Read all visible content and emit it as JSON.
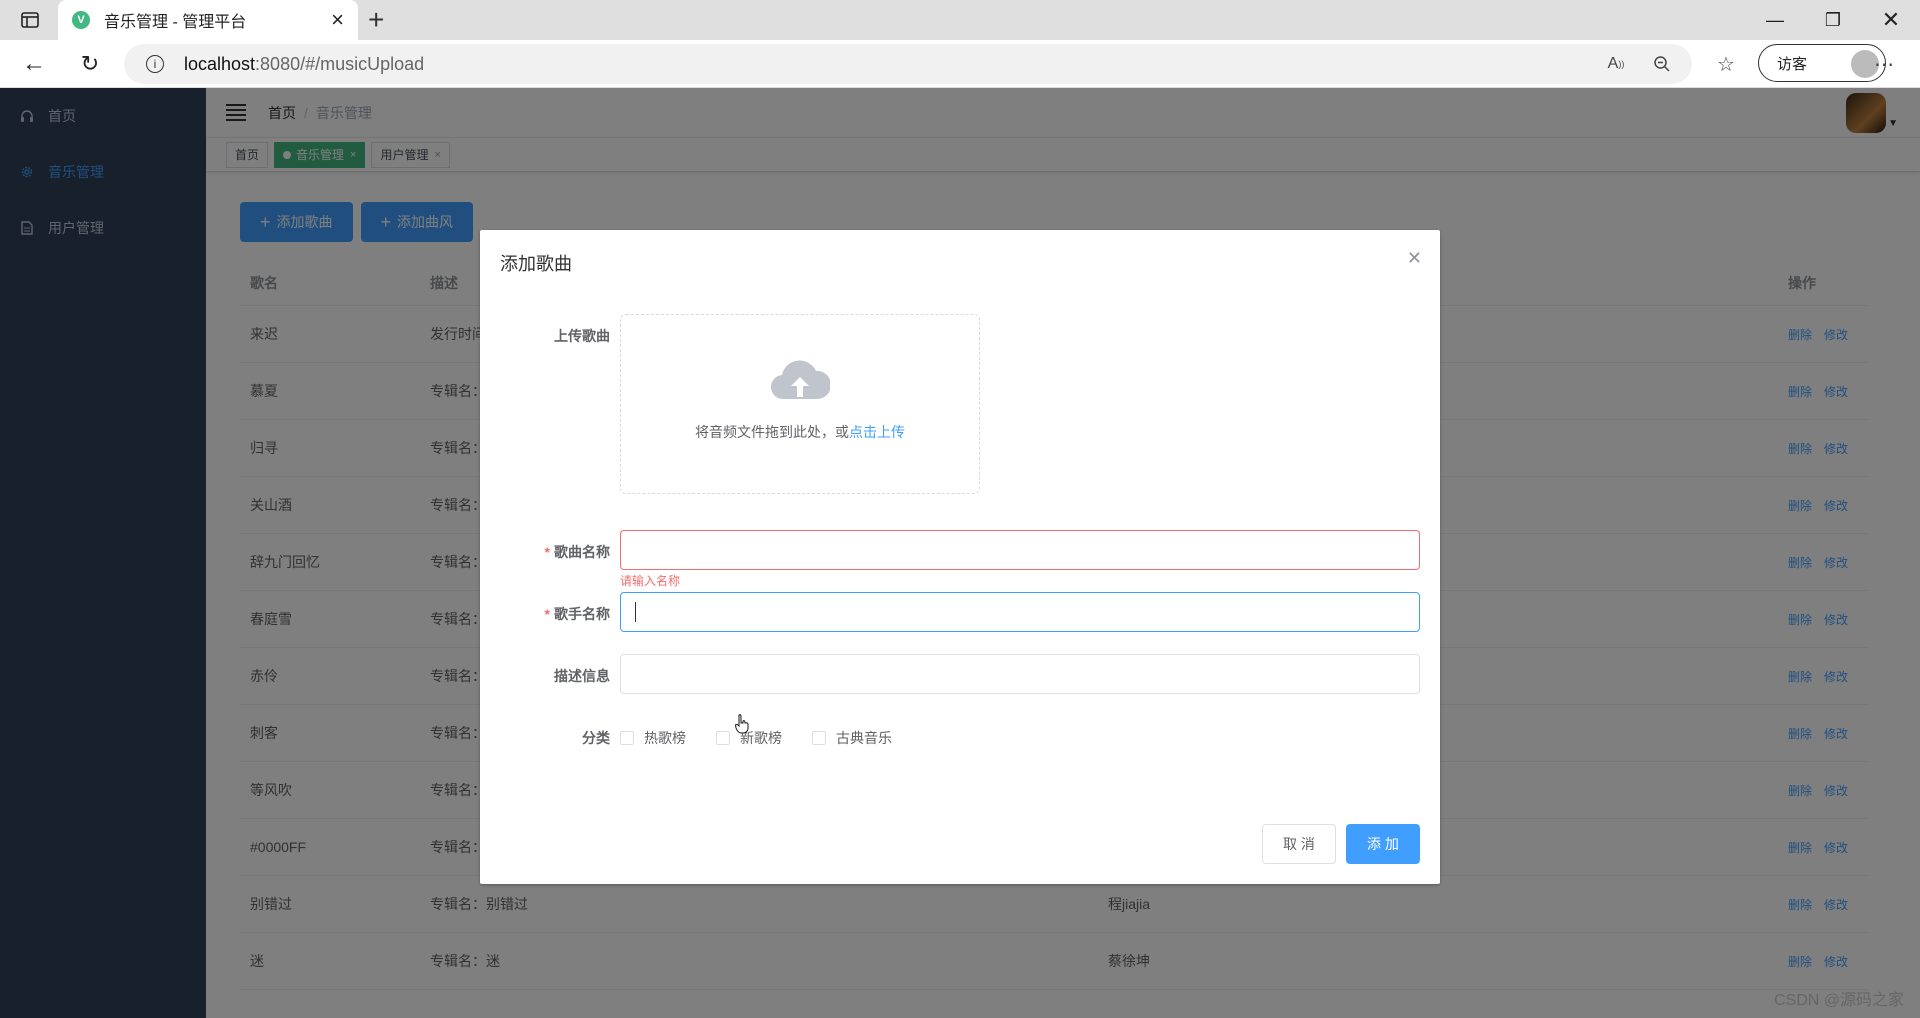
{
  "browser": {
    "tab_title": "音乐管理 - 管理平台",
    "url_host": "localhost",
    "url_path": ":8080/#/musicUpload",
    "guest_label": "访客"
  },
  "sidebar": {
    "items": [
      {
        "label": "首页"
      },
      {
        "label": "音乐管理"
      },
      {
        "label": "用户管理"
      }
    ]
  },
  "navbar": {
    "breadcrumb": [
      "首页",
      "/",
      "音乐管理"
    ]
  },
  "tags": [
    {
      "label": "首页"
    },
    {
      "label": "音乐管理",
      "close": "×"
    },
    {
      "label": "用户管理",
      "close": "×"
    }
  ],
  "toolbar": {
    "add_song": "添加歌曲",
    "add_genre": "添加曲风"
  },
  "table": {
    "headers": [
      "歌名",
      "描述",
      "",
      "操作"
    ],
    "rows": [
      {
        "name": "来迟",
        "desc": "发行时间",
        "singer": ""
      },
      {
        "name": "慕夏",
        "desc": "专辑名：",
        "singer": ""
      },
      {
        "name": "归寻",
        "desc": "专辑名：",
        "singer": ""
      },
      {
        "name": "关山酒",
        "desc": "专辑名：",
        "singer": ""
      },
      {
        "name": "辞九门回忆",
        "desc": "专辑名：",
        "singer": ""
      },
      {
        "name": "春庭雪",
        "desc": "专辑名：",
        "singer": ""
      },
      {
        "name": "赤伶",
        "desc": "专辑名：",
        "singer": ""
      },
      {
        "name": "刺客",
        "desc": "专辑名：",
        "singer": ""
      },
      {
        "name": "等风吹",
        "desc": "专辑名：",
        "singer": ""
      },
      {
        "name": "#0000FF",
        "desc": "专辑名：",
        "singer": ""
      },
      {
        "name": "别错过",
        "desc": "专辑名：别错过",
        "singer": "程jiajia"
      },
      {
        "name": "迷",
        "desc": "专辑名：迷",
        "singer": "蔡徐坤"
      }
    ],
    "delete_label": "删除",
    "edit_label": "修改"
  },
  "dialog": {
    "title": "添加歌曲",
    "upload_label": "上传歌曲",
    "upload_text": "将音频文件拖到此处，或",
    "upload_link": "点击上传",
    "song_name_label": "歌曲名称",
    "song_name_value": "",
    "song_name_error": "请输入名称",
    "singer_label": "歌手名称",
    "singer_value": "",
    "desc_label": "描述信息",
    "desc_value": "",
    "category_label": "分类",
    "categories": [
      {
        "label": "热歌榜",
        "checked": false
      },
      {
        "label": "新歌榜",
        "checked": false
      },
      {
        "label": "古典音乐",
        "checked": false
      }
    ],
    "cancel_label": "取 消",
    "add_label": "添 加"
  },
  "watermark": "CSDN @源码之家",
  "colors": {
    "primary": "#409eff",
    "sidebar_bg": "#304156",
    "tag_active": "#42b983",
    "error": "#f56c6c"
  }
}
